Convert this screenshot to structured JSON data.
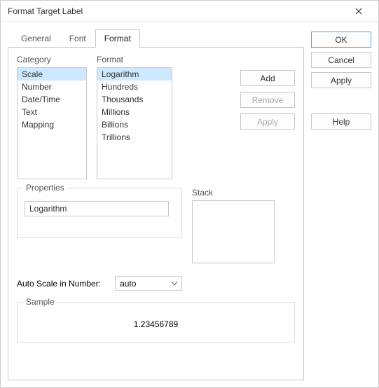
{
  "window": {
    "title": "Format Target Label"
  },
  "tabs": {
    "items": [
      "General",
      "Font",
      "Format"
    ],
    "active": 2
  },
  "category": {
    "label": "Category",
    "items": [
      "Scale",
      "Number",
      "Date/Time",
      "Text",
      "Mapping"
    ],
    "selected": 0
  },
  "format": {
    "label": "Format",
    "items": [
      "Logarithm",
      "Hundreds",
      "Thousands",
      "Millions",
      "Billions",
      "Trillions"
    ],
    "selected": 0
  },
  "actions": {
    "add": "Add",
    "remove": "Remove",
    "apply": "Apply"
  },
  "properties": {
    "legend": "Properties",
    "value": "Logarithm"
  },
  "stack": {
    "label": "Stack"
  },
  "autoScale": {
    "label": "Auto Scale in Number:",
    "value": "auto"
  },
  "sample": {
    "legend": "Sample",
    "value": "1.23456789"
  },
  "side": {
    "ok": "OK",
    "cancel": "Cancel",
    "apply": "Apply",
    "help": "Help"
  }
}
